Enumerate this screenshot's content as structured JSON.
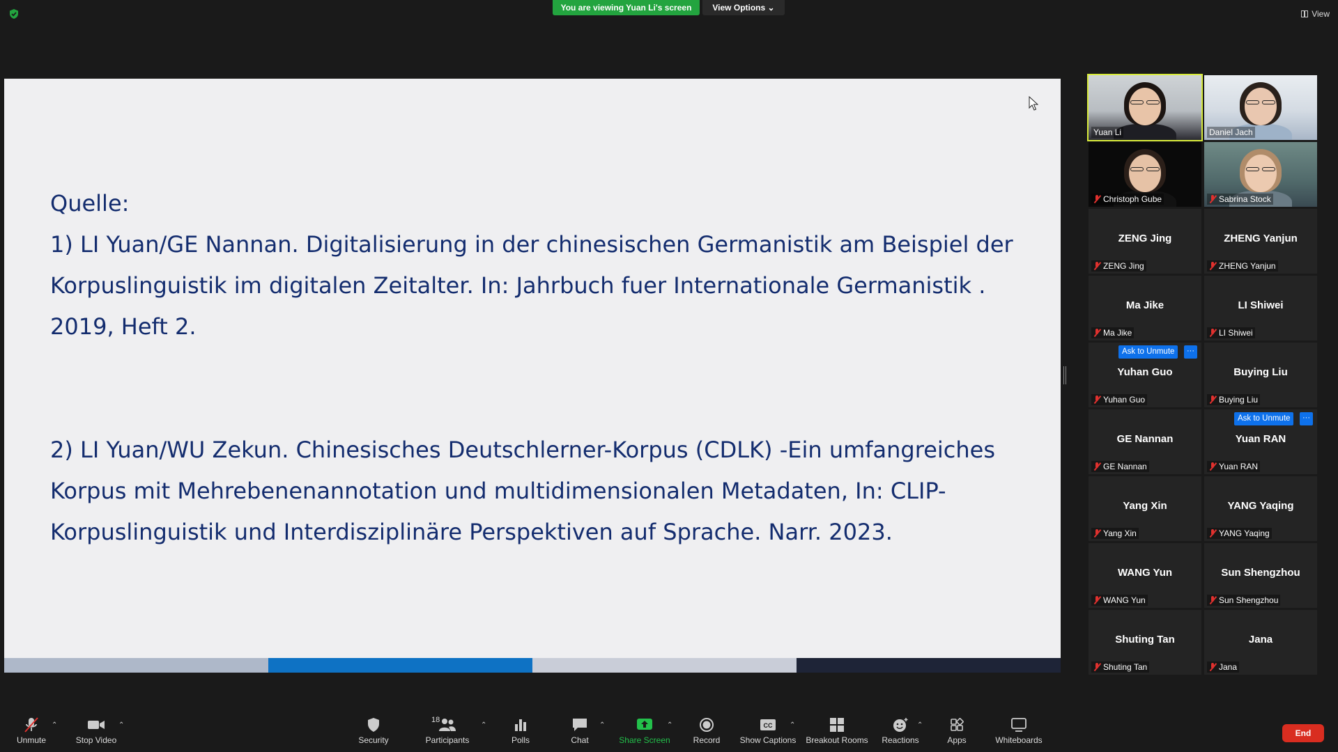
{
  "top": {
    "banner": "You are viewing Yuan Li's screen",
    "view_options": "View Options",
    "view_label": "View"
  },
  "slide": {
    "heading": "Quelle:",
    "ref1": "1) LI Yuan/GE Nannan. Digitalisierung in der chinesischen Germanistik am Beispiel der Korpuslinguistik im digitalen Zeitalter. In: Jahrbuch fuer Internationale Germanistik . 2019, Heft 2.",
    "ref2": "2) LI Yuan/WU Zekun. Chinesisches Deutschlerner-Korpus (CDLK) -Ein umfangreiches Korpus mit Mehrebenenannotation und multidimensionalen Metadaten, In: CLIP-Korpuslinguistik und Interdisziplinäre Perspektiven auf Sprache. Narr.  2023.",
    "bar_colors": [
      "#aeb8c9",
      "#0e72c4",
      "#c9cdd8",
      "#1e2437"
    ],
    "text_color": "#132c6e"
  },
  "participants": [
    {
      "name": "Yuan Li",
      "video": true,
      "muted": false,
      "speaking": true
    },
    {
      "name": "Daniel Jach",
      "video": true,
      "muted": false
    },
    {
      "name": "Christoph Gube",
      "video": true,
      "muted": true
    },
    {
      "name": "Sabrina Stock",
      "video": true,
      "muted": true
    },
    {
      "name": "ZENG Jing",
      "muted": true
    },
    {
      "name": "ZHENG Yanjun",
      "muted": true
    },
    {
      "name": "Ma Jike",
      "muted": true
    },
    {
      "name": "LI Shiwei",
      "muted": true
    },
    {
      "name": "Yuhan Guo",
      "muted": true,
      "ask_unmute": "Ask to Unmute"
    },
    {
      "name": "Buying Liu",
      "muted": true
    },
    {
      "name": "GE Nannan",
      "muted": true
    },
    {
      "name": "Yuan RAN",
      "muted": true,
      "ask_unmute": "Ask to Unmute"
    },
    {
      "name": "Yang Xin",
      "muted": true
    },
    {
      "name": "YANG Yaqing",
      "muted": true
    },
    {
      "name": "WANG Yun",
      "muted": true
    },
    {
      "name": "Sun Shengzhou",
      "muted": true
    },
    {
      "name": "Shuting Tan",
      "muted": true
    },
    {
      "name": "Jana",
      "muted": true
    }
  ],
  "ask_more": "···",
  "toolbar": {
    "unmute": "Unmute",
    "stop_video": "Stop Video",
    "security": "Security",
    "participants": "Participants",
    "participants_count": "18",
    "polls": "Polls",
    "chat": "Chat",
    "share_screen": "Share Screen",
    "record": "Record",
    "show_captions": "Show Captions",
    "breakout_rooms": "Breakout Rooms",
    "reactions": "Reactions",
    "apps": "Apps",
    "whiteboards": "Whiteboards",
    "end": "End"
  },
  "colors": {
    "banner_green": "#23a43f",
    "speaking_outline": "#d7ea3a",
    "ask_blue": "#0e71eb",
    "end_red": "#d92d20"
  }
}
